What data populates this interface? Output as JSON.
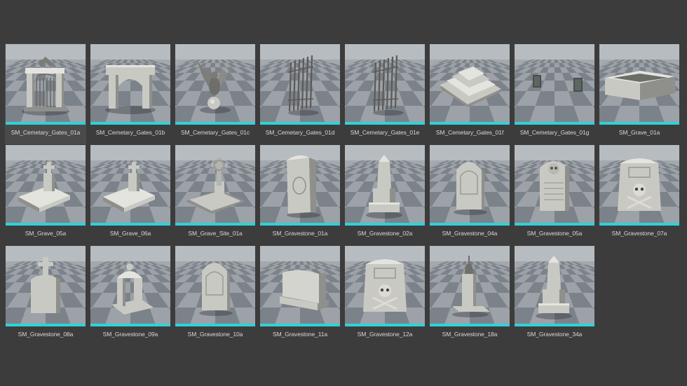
{
  "content_browser": {
    "accent_color": "#2fd2d7",
    "selected_index": 0,
    "assets": [
      {
        "name": "SM_Cemetary_Gates_01a",
        "icon": "gate-pillars-crest-icon"
      },
      {
        "name": "SM_Cemetary_Gates_01b",
        "icon": "stone-arch-icon"
      },
      {
        "name": "SM_Cemetary_Gates_01c",
        "icon": "eagle-statue-icon"
      },
      {
        "name": "SM_Cemetary_Gates_01d",
        "icon": "iron-fence-icon"
      },
      {
        "name": "SM_Cemetary_Gates_01e",
        "icon": "iron-fence-icon"
      },
      {
        "name": "SM_Cemetary_Gates_01f",
        "icon": "stone-steps-icon"
      },
      {
        "name": "SM_Cemetary_Gates_01g",
        "icon": "plaques-icon"
      },
      {
        "name": "SM_Grave_01a",
        "icon": "open-grave-icon"
      },
      {
        "name": "SM_Grave_05a",
        "icon": "grave-cross-slab-icon"
      },
      {
        "name": "SM_Grave_06a",
        "icon": "grave-cross-slab-icon"
      },
      {
        "name": "SM_Grave_Site_01a",
        "icon": "celtic-cross-icon"
      },
      {
        "name": "SM_Gravestone_01a",
        "icon": "tall-slab-icon"
      },
      {
        "name": "SM_Gravestone_02a",
        "icon": "obelisk-icon"
      },
      {
        "name": "SM_Gravestone_04a",
        "icon": "round-headstone-icon"
      },
      {
        "name": "SM_Gravestone_05a",
        "icon": "skull-headstone-icon"
      },
      {
        "name": "SM_Gravestone_07a",
        "icon": "skull-crossbones-headstone-icon"
      },
      {
        "name": "SM_Gravestone_08a",
        "icon": "cross-headstone-icon"
      },
      {
        "name": "SM_Gravestone_09a",
        "icon": "twin-pillar-headstone-icon"
      },
      {
        "name": "SM_Gravestone_10a",
        "icon": "round-headstone-icon"
      },
      {
        "name": "SM_Gravestone_11a",
        "icon": "low-slab-icon"
      },
      {
        "name": "SM_Gravestone_12a",
        "icon": "skull-crossbones-headstone-icon"
      },
      {
        "name": "SM_Gravestone_18a",
        "icon": "urn-pillar-icon"
      },
      {
        "name": "SM_Gravestone_34a",
        "icon": "obelisk-icon"
      }
    ]
  }
}
